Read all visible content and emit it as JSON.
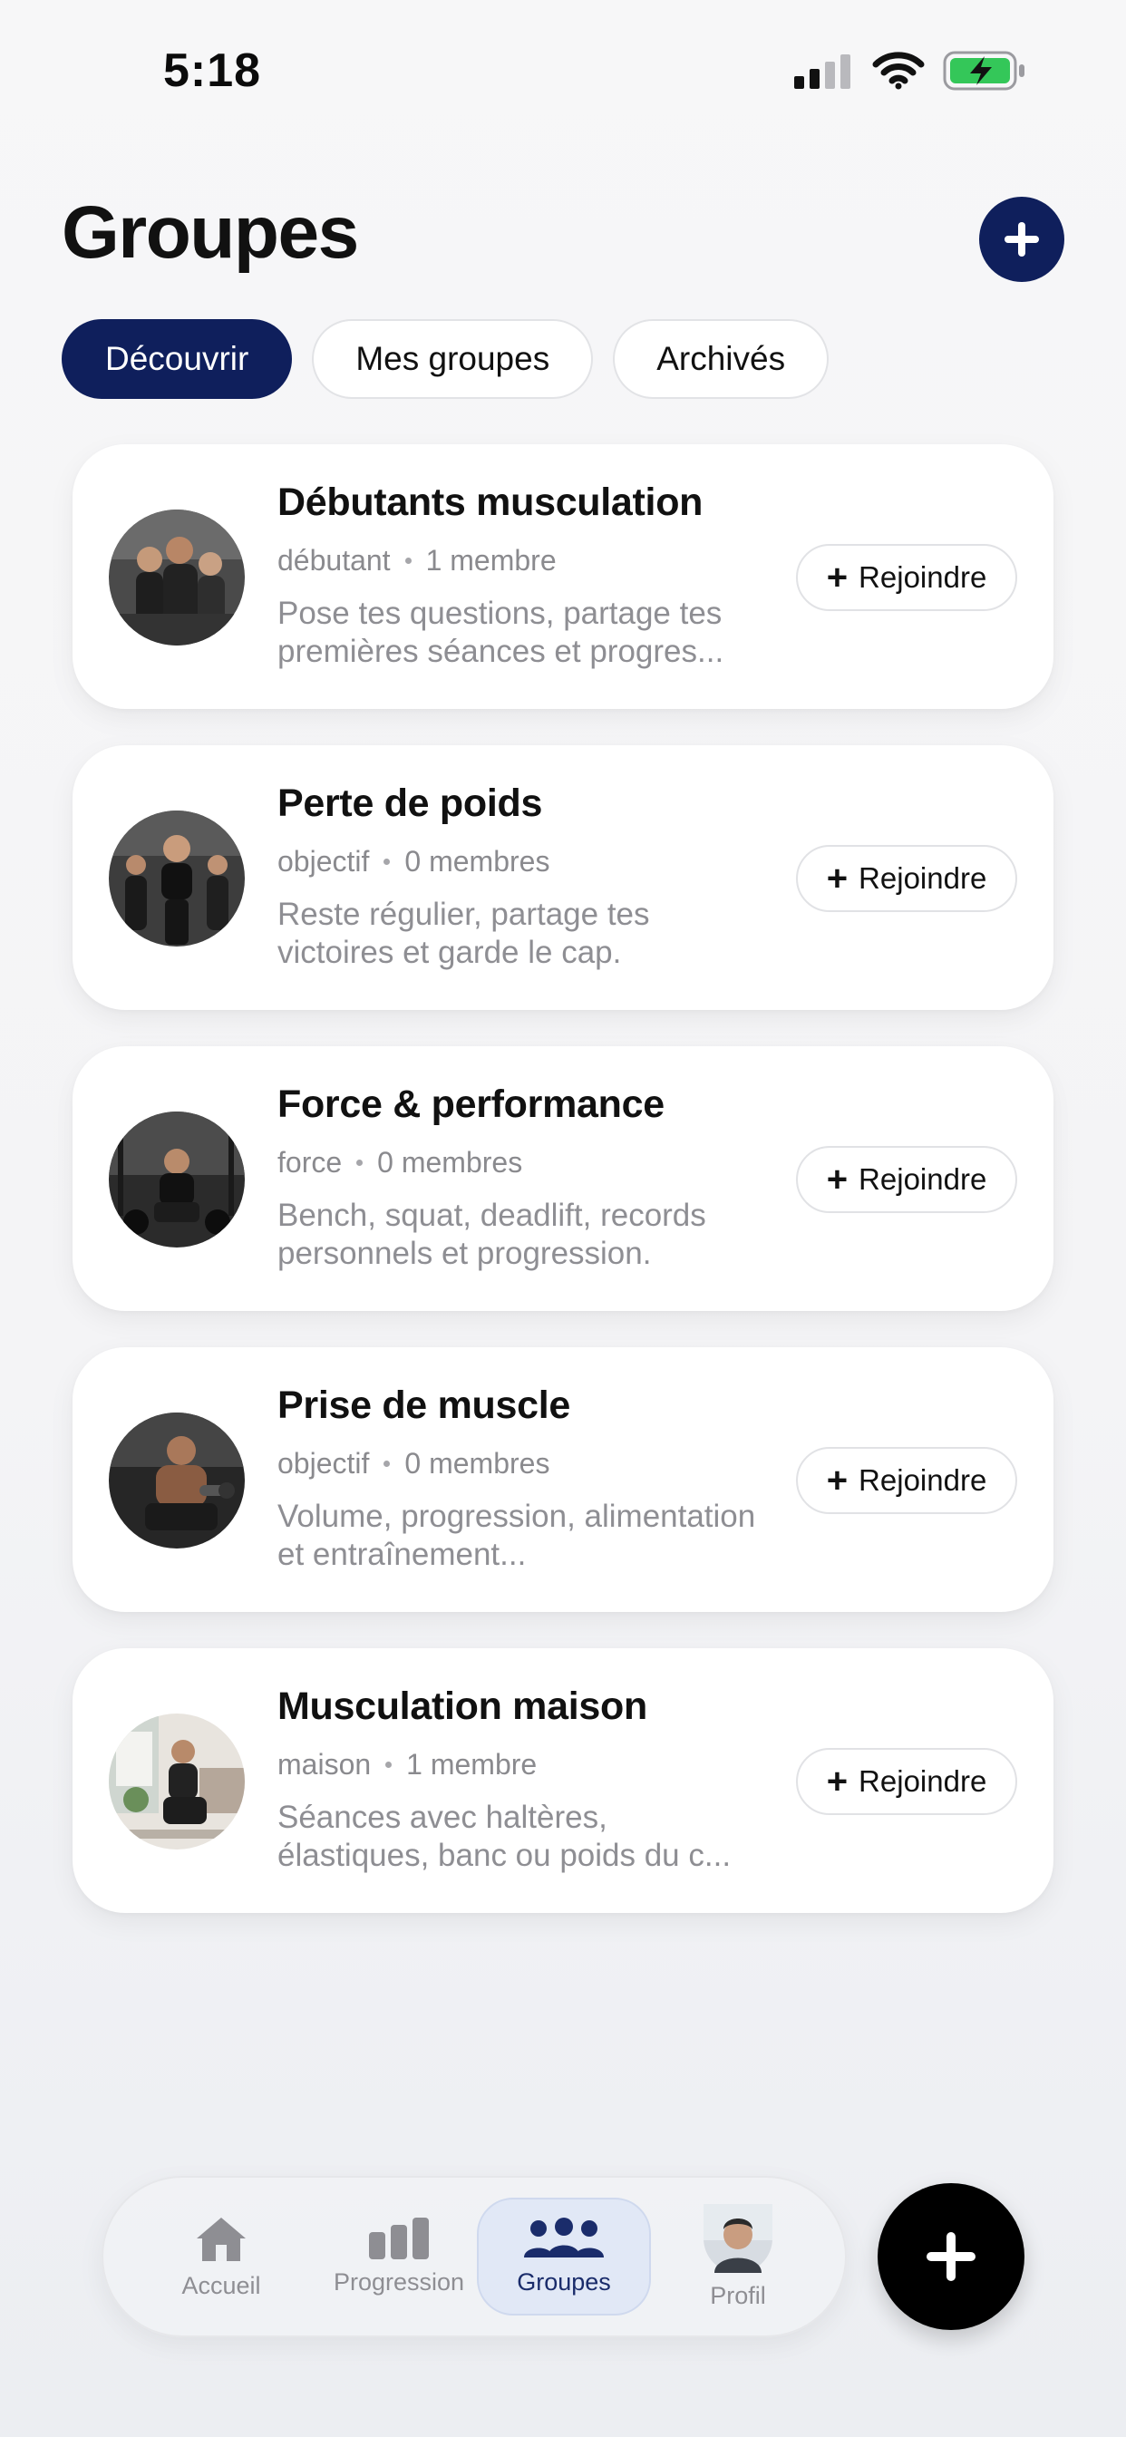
{
  "status_bar": {
    "time": "5:18"
  },
  "header": {
    "title": "Groupes"
  },
  "tabs": [
    {
      "label": "Découvrir",
      "active": true
    },
    {
      "label": "Mes groupes",
      "active": false
    },
    {
      "label": "Archivés",
      "active": false
    }
  ],
  "groups": [
    {
      "title": "Débutants musculation",
      "tag": "débutant",
      "members": "1 membre",
      "description": "Pose tes questions, partage tes premières séances et progres...",
      "join_label": "Rejoindre"
    },
    {
      "title": "Perte de poids",
      "tag": "objectif",
      "members": "0 membres",
      "description": "Reste régulier, partage tes victoires et garde le cap.",
      "join_label": "Rejoindre"
    },
    {
      "title": "Force & performance",
      "tag": "force",
      "members": "0 membres",
      "description": "Bench, squat, deadlift, records personnels et progression.",
      "join_label": "Rejoindre"
    },
    {
      "title": "Prise de muscle",
      "tag": "objectif",
      "members": "0 membres",
      "description": "Volume, progression, alimentation et entraînement...",
      "join_label": "Rejoindre"
    },
    {
      "title": "Musculation maison",
      "tag": "maison",
      "members": "1 membre",
      "description": "Séances avec haltères, élastiques, banc ou poids du c...",
      "join_label": "Rejoindre"
    }
  ],
  "bottom_nav": {
    "items": [
      {
        "label": "Accueil",
        "icon": "home-icon",
        "active": false
      },
      {
        "label": "Progression",
        "icon": "bar-chart-icon",
        "active": false
      },
      {
        "label": "Groupes",
        "icon": "users-icon",
        "active": true
      },
      {
        "label": "Profil",
        "icon": "profile-avatar",
        "active": false
      }
    ]
  },
  "colors": {
    "primary": "#0f1f5c",
    "background": "#f4f4f6",
    "card": "#ffffff",
    "muted_text": "#8e8e93",
    "battery_green": "#34c759",
    "fab": "#000000"
  }
}
